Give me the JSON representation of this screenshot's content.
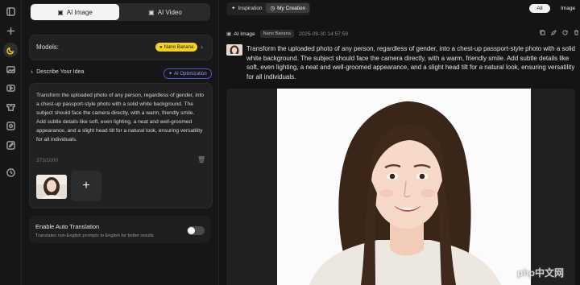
{
  "nav": {
    "icons": [
      "panel-icon",
      "plus-icon",
      "moon-icon",
      "image-icon",
      "video-icon",
      "hanger-icon",
      "grid-icon",
      "edit-image-icon",
      "clock-icon"
    ]
  },
  "mode_tabs": {
    "image": "AI Image",
    "video": "AI Video"
  },
  "models": {
    "label": "Models:",
    "selected": "Nano Banana"
  },
  "describe": {
    "label": "Describe Your Idea",
    "ai_optimization": "AI Optimization"
  },
  "prompt": {
    "text": "Transform the uploaded photo of any person, regardless of gender, into a chest-up passport-style photo with a solid white background. The subject should face the camera directly, with a warm, friendly smile. Add subtle details like soft, even lighting, a neat and well-groomed appearance, and a slight head tilt for a natural look, ensuring versatility for all individuals.",
    "count": "373/1000",
    "add_symbol": "+"
  },
  "translation": {
    "title": "Enable Auto Translation",
    "subtitle": "Translates non-English prompts to English for better results",
    "enabled": false
  },
  "top_tabs": {
    "inspiration": "Inspiration",
    "my_creation": "My Creation"
  },
  "filters": {
    "all": "All",
    "image": "Image"
  },
  "creation": {
    "type": "AI Image",
    "model": "Nano Banana",
    "timestamp": "2025-09-30 14:57:59",
    "prompt": "Transform the uploaded photo of any person, regardless of gender, into a chest-up passport-style photo with a solid white background. The subject should face the camera directly, with a warm, friendly smile. Add subtle details like soft, even lighting, a neat and well-groomed appearance, and a slight head tilt for a natural look, ensuring versatility for all individuals."
  },
  "watermark": "php中文网",
  "colors": {
    "accent": "#f2d21e",
    "ai_opt": "#8c96ff",
    "bg": "#141414"
  }
}
